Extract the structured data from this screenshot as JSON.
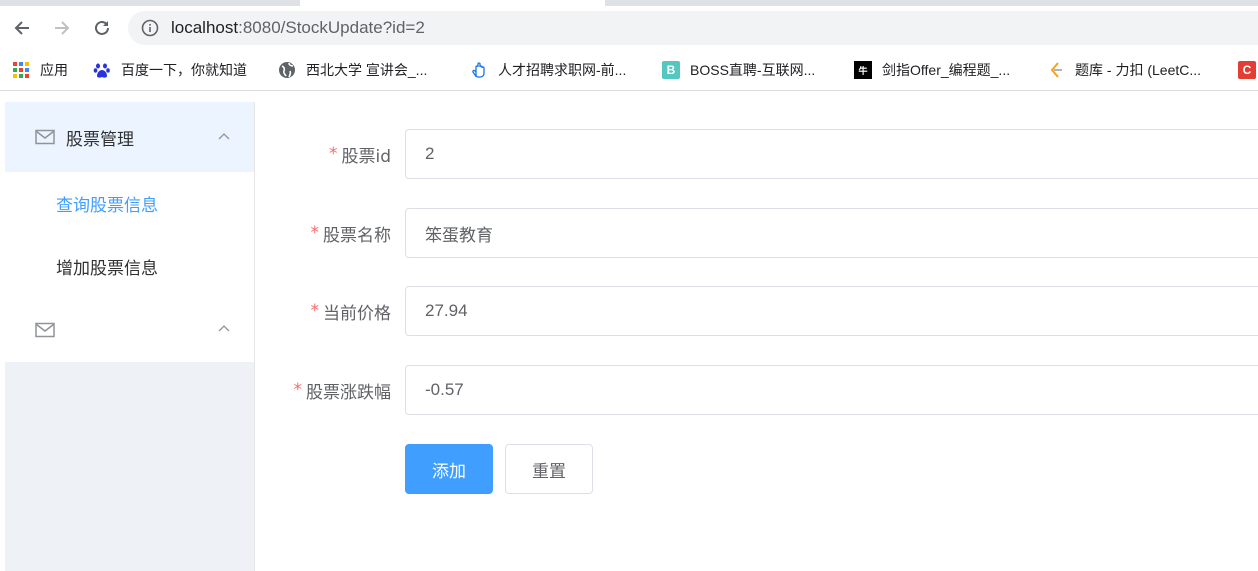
{
  "browser": {
    "url_host": "localhost",
    "url_path": ":8080/StockUpdate?id=2",
    "bookmarks": [
      {
        "label": "应用",
        "icon": "apps-grid-icon"
      },
      {
        "label": "百度一下，你就知道",
        "icon": "baidu-paw-icon"
      },
      {
        "label": "西北大学 宣讲会_...",
        "icon": "globe-icon"
      },
      {
        "label": "人才招聘求职网-前...",
        "icon": "hand-icon"
      },
      {
        "label": "BOSS直聘-互联网...",
        "icon": "boss-b-icon"
      },
      {
        "label": "剑指Offer_编程题_...",
        "icon": "nowcoder-icon"
      },
      {
        "label": "题库 - 力扣 (LeetC...",
        "icon": "leetcode-icon"
      }
    ]
  },
  "sidebar": {
    "groups": [
      {
        "title": "股票管理",
        "icon": "mail-icon",
        "open": true,
        "items": [
          {
            "label": "查询股票信息",
            "active": true
          },
          {
            "label": "增加股票信息",
            "active": false
          }
        ]
      },
      {
        "title": "",
        "icon": "mail-icon",
        "open": true,
        "items": []
      }
    ]
  },
  "form": {
    "fields": [
      {
        "label": "股票id",
        "value": "2",
        "required": true
      },
      {
        "label": "股票名称",
        "value": "笨蛋教育",
        "required": true
      },
      {
        "label": "当前价格",
        "value": "27.94",
        "required": true
      },
      {
        "label": "股票涨跌幅",
        "value": "-0.57",
        "required": true
      }
    ],
    "submit_label": "添加",
    "reset_label": "重置"
  },
  "colors": {
    "primary": "#409eff",
    "required_star": "#f56c6c",
    "sidebar_bg": "#eef1f6",
    "active_submenu_bg": "#ecf5ff"
  }
}
